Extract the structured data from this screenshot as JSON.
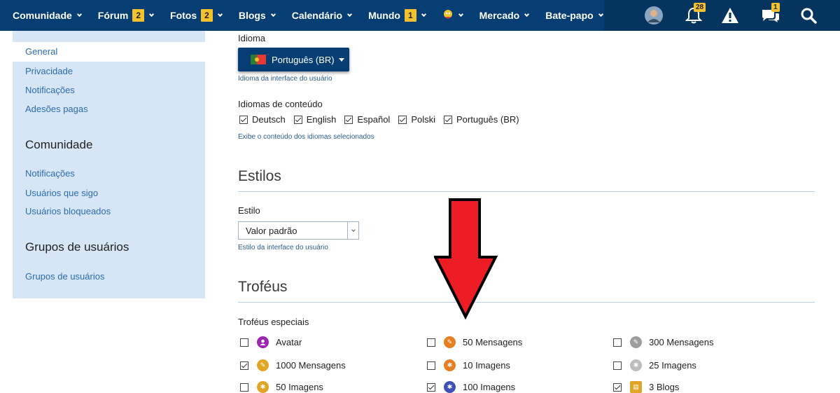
{
  "nav": {
    "items": [
      {
        "label": "Comunidade",
        "badge": null
      },
      {
        "label": "Fórum",
        "badge": "2"
      },
      {
        "label": "Fotos",
        "badge": "2"
      },
      {
        "label": "Blogs",
        "badge": null
      },
      {
        "label": "Calendário",
        "badge": null
      },
      {
        "label": "Mundo",
        "badge": "1"
      },
      {
        "label": "",
        "badge": null
      },
      {
        "label": "Mercado",
        "badge": null
      },
      {
        "label": "Bate-papo",
        "badge": null
      }
    ],
    "right": {
      "notifications_count": "28",
      "conversations_count": "1"
    },
    "icons": [
      "user-avatar-icon",
      "bell-icon",
      "warning-icon",
      "chat-bubbles-icon",
      "search-icon"
    ]
  },
  "sidebar": {
    "items": [
      "General",
      "Privacidade",
      "Notificações",
      "Adesões pagas"
    ],
    "section_comunidade": "Comunidade",
    "comunidade_items": [
      "Notificações",
      "Usuários que sigo",
      "Usuários bloqueados"
    ],
    "section_grupos": "Grupos de usuários",
    "grupos_items": [
      "Grupos de usuários"
    ]
  },
  "main": {
    "idioma_label": "Idioma",
    "language_button": "Português (BR)",
    "idioma_hint": "Idioma da interface do usuário",
    "content_lang_label": "Idiomas de conteúdo",
    "content_langs": [
      {
        "label": "Deutsch",
        "checked": true
      },
      {
        "label": "English",
        "checked": true
      },
      {
        "label": "Español",
        "checked": true
      },
      {
        "label": "Polski",
        "checked": true
      },
      {
        "label": "Português (BR)",
        "checked": true
      }
    ],
    "content_lang_hint": "Exibe o conteúdo dos idiomas selecionados",
    "styles_heading": "Estilos",
    "style_label": "Estilo",
    "style_value": "Valor padrão",
    "style_hint": "Estilo da interface do usuário",
    "trophies_heading": "Troféus",
    "special_trophies_label": "Troféus especiais",
    "trophies": [
      {
        "label": "Avatar",
        "checked": false,
        "color": "#9c27b0",
        "icon": "user-icon"
      },
      {
        "label": "50 Mensagens",
        "checked": false,
        "color": "#e67e22",
        "icon": "trophy-orange-icon"
      },
      {
        "label": "300 Mensagens",
        "checked": false,
        "color": "#9e9e9e",
        "icon": "trophy-grey-icon"
      },
      {
        "label": "1000 Mensagens",
        "checked": true,
        "color": "#e0a526",
        "icon": "trophy-gold-icon"
      },
      {
        "label": "10 Imagens",
        "checked": false,
        "color": "#e67e22",
        "icon": "camera-orange-icon"
      },
      {
        "label": "25 Imagens",
        "checked": false,
        "color": "#9e9e9e",
        "icon": "camera-grey-icon"
      },
      {
        "label": "50 Imagens",
        "checked": false,
        "color": "#e0a526",
        "icon": "camera-gold-icon"
      },
      {
        "label": "100 Imagens",
        "checked": true,
        "color": "#3f51b5",
        "icon": "camera-blue-icon"
      },
      {
        "label": "3 Blogs",
        "checked": true,
        "color": "#e0a526",
        "icon": "blog-gold-icon"
      }
    ]
  },
  "annotation": {
    "color": "#ee1c25",
    "icon": "red-down-arrow"
  }
}
